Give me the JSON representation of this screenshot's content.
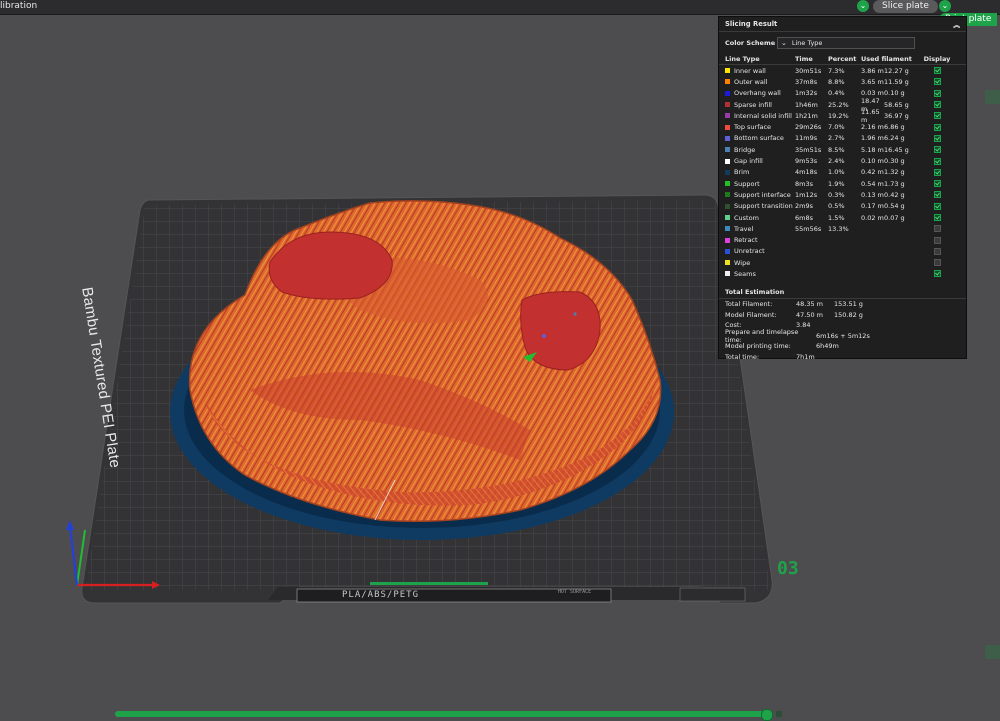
{
  "window": {
    "title": "libration"
  },
  "toolbar": {
    "slice_label": "Slice plate",
    "print_label": "Print plate"
  },
  "plate": {
    "name": "Bambu Textured PEI Plate",
    "number": "03",
    "materials": "PLA/ABS/PETG",
    "hot_surface": "HOT SURFACE"
  },
  "slicing_result": {
    "title": "Slicing Result",
    "color_scheme_label": "Color Scheme",
    "color_scheme_value": "Line Type",
    "columns": [
      "Line Type",
      "Time",
      "Percent",
      "Used filament",
      "Display"
    ],
    "rows": [
      {
        "name": "Inner wall",
        "color": "#ffe600",
        "time": "30m51s",
        "percent": "7.3%",
        "length": "3.86 m",
        "weight": "12.27 g",
        "display": true
      },
      {
        "name": "Outer wall",
        "color": "#ff7f00",
        "time": "37m8s",
        "percent": "8.8%",
        "length": "3.65 m",
        "weight": "11.59 g",
        "display": true
      },
      {
        "name": "Overhang wall",
        "color": "#1a1ae0",
        "time": "1m32s",
        "percent": "0.4%",
        "length": "0.03 m",
        "weight": "0.10 g",
        "display": true
      },
      {
        "name": "Sparse infill",
        "color": "#b03131",
        "time": "1h46m",
        "percent": "25.2%",
        "length": "18.47 m",
        "weight": "58.65 g",
        "display": true
      },
      {
        "name": "Internal solid infill",
        "color": "#9b3aa6",
        "time": "1h21m",
        "percent": "19.2%",
        "length": "11.65 m",
        "weight": "36.97 g",
        "display": true
      },
      {
        "name": "Top surface",
        "color": "#ef4a3a",
        "time": "29m26s",
        "percent": "7.0%",
        "length": "2.16 m",
        "weight": "6.86 g",
        "display": true
      },
      {
        "name": "Bottom surface",
        "color": "#6060d8",
        "time": "11m9s",
        "percent": "2.7%",
        "length": "1.96 m",
        "weight": "6.24 g",
        "display": true
      },
      {
        "name": "Bridge",
        "color": "#4d7fb0",
        "time": "35m51s",
        "percent": "8.5%",
        "length": "5.18 m",
        "weight": "16.45 g",
        "display": true
      },
      {
        "name": "Gap infill",
        "color": "#ffffff",
        "time": "9m53s",
        "percent": "2.4%",
        "length": "0.10 m",
        "weight": "0.30 g",
        "display": true
      },
      {
        "name": "Brim",
        "color": "#113a5c",
        "time": "4m18s",
        "percent": "1.0%",
        "length": "0.42 m",
        "weight": "1.32 g",
        "display": true
      },
      {
        "name": "Support",
        "color": "#22c022",
        "time": "8m3s",
        "percent": "1.9%",
        "length": "0.54 m",
        "weight": "1.73 g",
        "display": true
      },
      {
        "name": "Support interface",
        "color": "#1d7a1d",
        "time": "1m12s",
        "percent": "0.3%",
        "length": "0.13 m",
        "weight": "0.42 g",
        "display": true
      },
      {
        "name": "Support transition",
        "color": "#2f4f2f",
        "time": "2m9s",
        "percent": "0.5%",
        "length": "0.17 m",
        "weight": "0.54 g",
        "display": true
      },
      {
        "name": "Custom",
        "color": "#5ed08a",
        "time": "6m8s",
        "percent": "1.5%",
        "length": "0.02 m",
        "weight": "0.07 g",
        "display": true
      },
      {
        "name": "Travel",
        "color": "#3a8ac0",
        "time": "55m56s",
        "percent": "13.3%",
        "length": "",
        "weight": "",
        "display": false
      },
      {
        "name": "Retract",
        "color": "#e040e0",
        "time": "",
        "percent": "",
        "length": "",
        "weight": "",
        "display": false
      },
      {
        "name": "Unretract",
        "color": "#2a4fd8",
        "time": "",
        "percent": "",
        "length": "",
        "weight": "",
        "display": false
      },
      {
        "name": "Wipe",
        "color": "#f0e020",
        "time": "",
        "percent": "",
        "length": "",
        "weight": "",
        "display": false
      },
      {
        "name": "Seams",
        "color": "#eeeeee",
        "time": "",
        "percent": "",
        "length": "",
        "weight": "",
        "display": true
      }
    ],
    "total_title": "Total Estimation",
    "totals": [
      {
        "label": "Total Filament:",
        "v1": "48.35 m",
        "v2": "153.51 g"
      },
      {
        "label": "Model Filament:",
        "v1": "47.50 m",
        "v2": "150.82 g"
      },
      {
        "label": "Cost:",
        "v1": "3.84",
        "v2": ""
      },
      {
        "label": "Prepare and timelapse time:",
        "v1": "6m16s + 5m12s",
        "v2": ""
      },
      {
        "label": "Model printing time:",
        "v1": "6h49m",
        "v2": ""
      },
      {
        "label": "Total time:",
        "v1": "7h1m",
        "v2": ""
      }
    ]
  },
  "layer_slider": {
    "progress": 0.99
  }
}
